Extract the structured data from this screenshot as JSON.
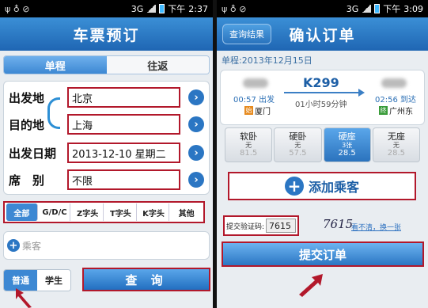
{
  "screen1": {
    "status": {
      "left_icons": "ψ ♁ ⊘",
      "network": "3G",
      "time_prefix": "下午",
      "time": "2:37"
    },
    "title": "车票预订",
    "tabs": [
      "单程",
      "往返"
    ],
    "form": {
      "from_label": "出发地",
      "from_value": "北京",
      "to_label": "目的地",
      "to_value": "上海",
      "date_label": "出发日期",
      "date_value": "2013-12-10 星期二",
      "seat_label": "席　别",
      "seat_value": "不限"
    },
    "filters": [
      "全部",
      "G/D/C",
      "Z字头",
      "T字头",
      "K字头",
      "其他"
    ],
    "passenger_placeholder": "乘客",
    "ticket_types": [
      "普通",
      "学生"
    ],
    "query_label": "查 询"
  },
  "screen2": {
    "status": {
      "left_icons": "ψ ♁ ⊘",
      "network": "3G",
      "time_prefix": "下午",
      "time": "3:09"
    },
    "back_label": "查询结果",
    "title": "确认订单",
    "date_text": "单程:2013年12月15日",
    "train": {
      "number": "K299",
      "depart_time": "00:57 出发",
      "arrive_time": "02:56 到达",
      "duration": "01小时59分钟",
      "from_station": "厦门",
      "to_station": "广州东",
      "from_tag": "始",
      "to_tag": "终"
    },
    "seats": [
      {
        "name": "软卧",
        "avail": "无",
        "price": "81.5"
      },
      {
        "name": "硬卧",
        "avail": "无",
        "price": "57.5"
      },
      {
        "name": "硬座",
        "avail": "3张",
        "price": "28.5"
      },
      {
        "name": "无座",
        "avail": "无",
        "price": "28.5"
      }
    ],
    "add_passenger": "添加乘客",
    "verify_label": "提交验证码:",
    "verify_value": "7615",
    "captcha_text": "7615",
    "refresh_link": "看不清，换一张",
    "submit_label": "提交订单"
  },
  "colors": {
    "accent": "#2b76c3",
    "highlight_border": "#b2182b"
  }
}
